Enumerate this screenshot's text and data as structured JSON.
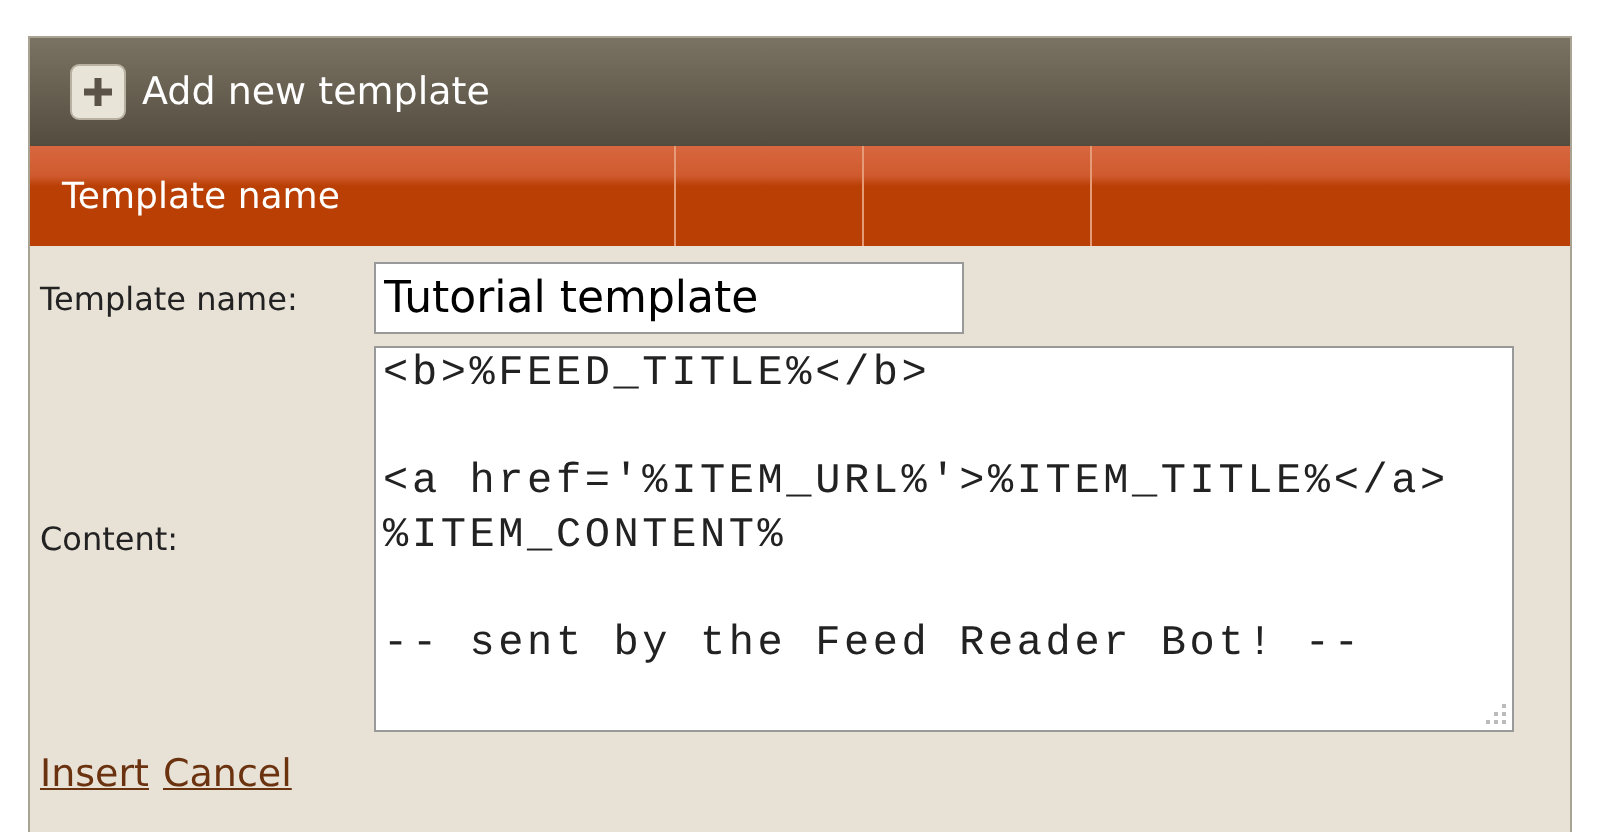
{
  "header": {
    "button_label": "Add new template"
  },
  "table": {
    "columns": [
      "Template name",
      "",
      "",
      ""
    ]
  },
  "form": {
    "name_label": "Template name:",
    "name_value": "Tutorial template",
    "content_label": "Content:",
    "content_value": "<b>%FEED_TITLE%</b>\n\n<a href='%ITEM_URL%'>%ITEM_TITLE%</a>\n%ITEM_CONTENT%\n\n-- sent by the Feed Reader Bot! --"
  },
  "links": [
    "Insert",
    "Cancel"
  ]
}
